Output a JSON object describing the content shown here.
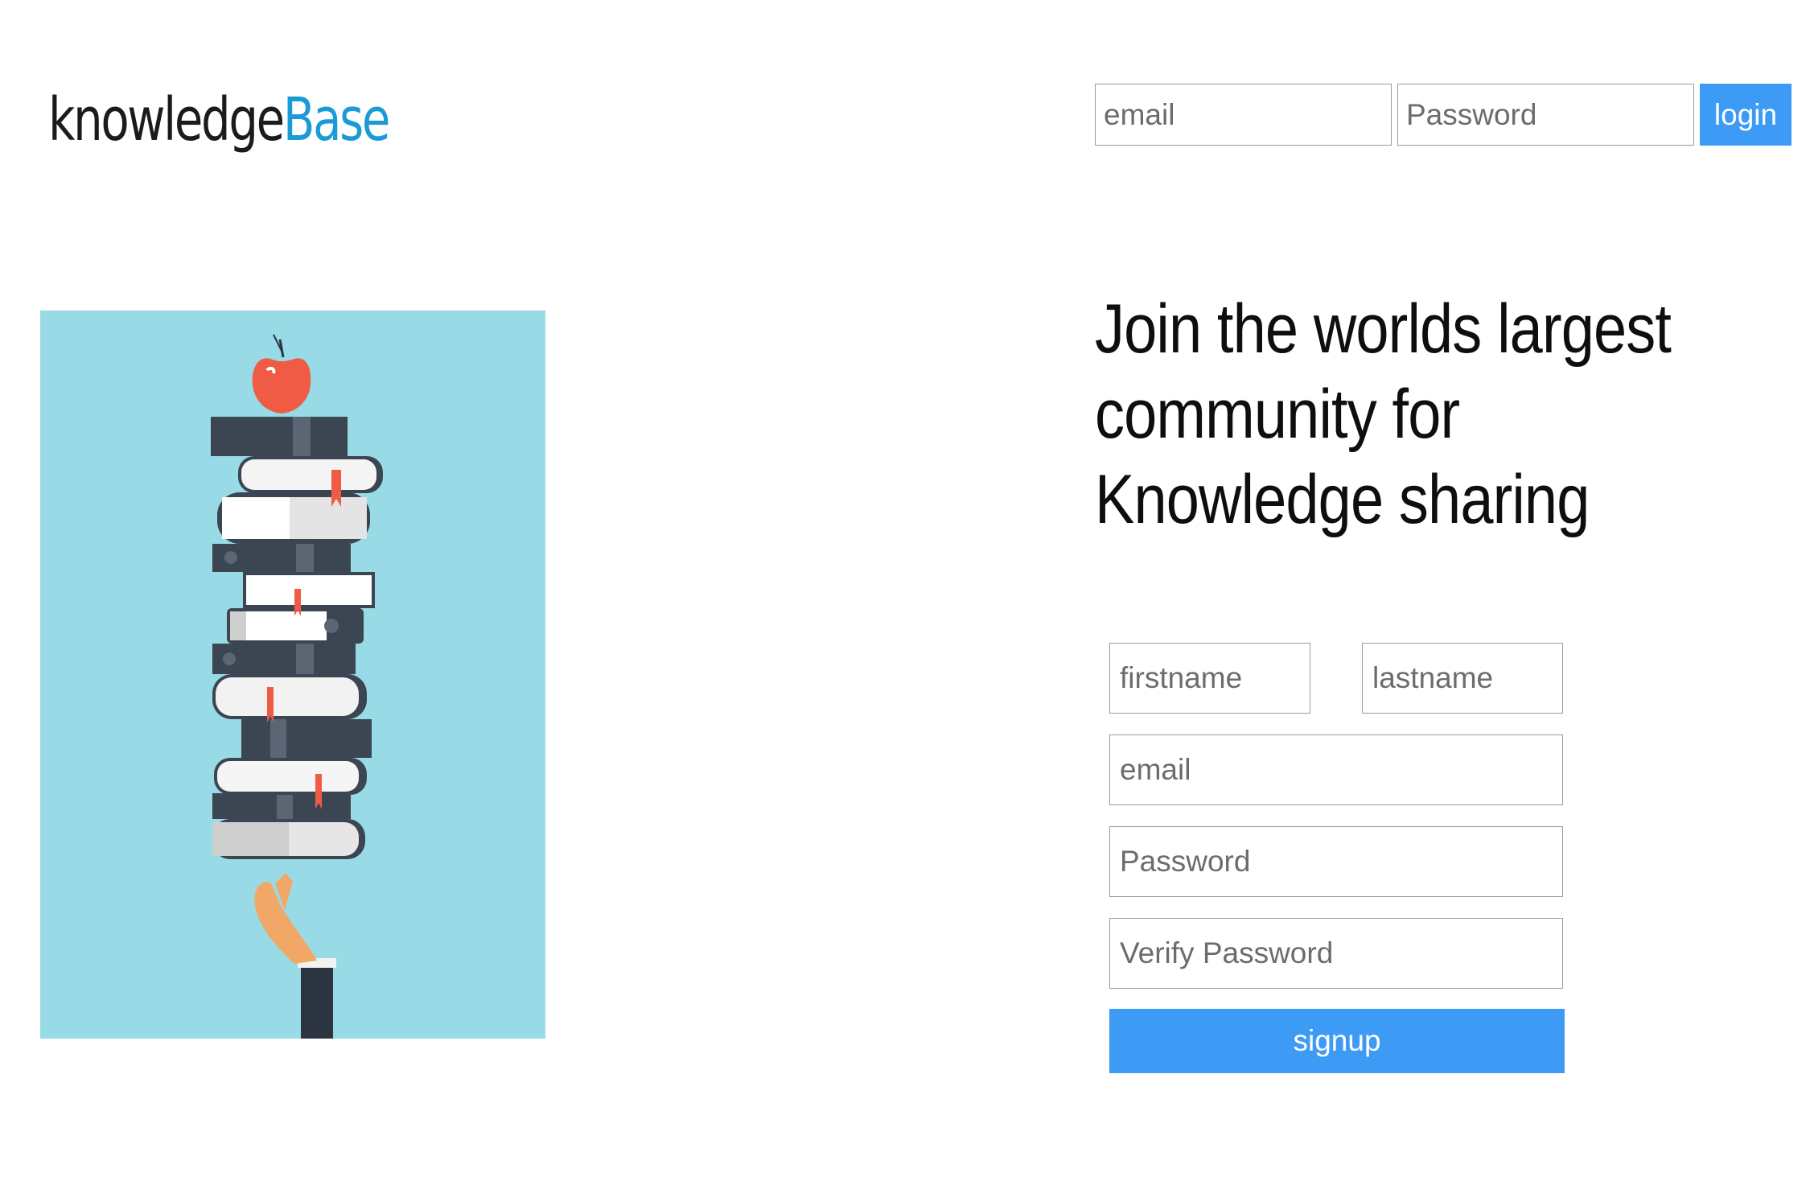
{
  "brand": {
    "logo_part_1": "knowledge",
    "logo_part_2": "Base",
    "color_dark": "#1b1b1b",
    "color_accent": "#1a9bd7"
  },
  "login": {
    "email_placeholder": "email",
    "password_placeholder": "Password",
    "button_label": "login"
  },
  "hero": {
    "headline_lines": [
      "Join the worlds largest",
      "community for",
      "Knowledge sharing"
    ],
    "illustration_icon": "books-stack-with-apple-illustration"
  },
  "signup": {
    "firstname_placeholder": "firstname",
    "lastname_placeholder": "lastname",
    "email_placeholder": "email",
    "password_placeholder": "Password",
    "verify_password_placeholder": "Verify Password",
    "button_label": "signup"
  },
  "colors": {
    "primary_button": "#3d9bf5",
    "illustration_background": "#98dbe6"
  }
}
